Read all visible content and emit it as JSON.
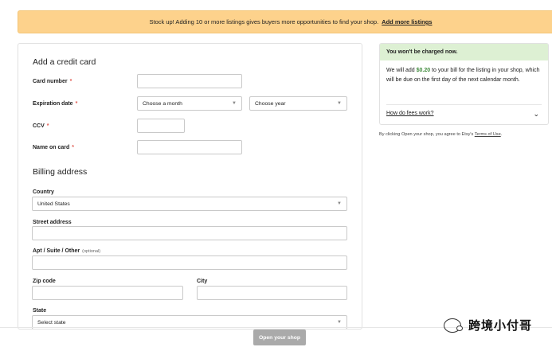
{
  "banner": {
    "text": "Stock up! Adding 10 or more listings gives buyers more opportunities to find your shop.",
    "link": "Add more listings"
  },
  "credit_card": {
    "title": "Add a credit card",
    "card_number_label": "Card number",
    "expiration_label": "Expiration date",
    "month_select": "Choose a month",
    "year_select": "Choose year",
    "ccv_label": "CCV",
    "name_label": "Name on card",
    "required_mark": "*"
  },
  "billing": {
    "title": "Billing address",
    "country_label": "Country",
    "country_value": "United States",
    "street_label": "Street address",
    "apt_label": "Apt / Suite / Other",
    "apt_optional": "(optional)",
    "zip_label": "Zip code",
    "city_label": "City",
    "state_label": "State",
    "state_value": "Select state"
  },
  "sidebar": {
    "header": "You won't be charged now.",
    "body_pre": "We will add ",
    "amount": "$0.20",
    "body_post": " to your bill for the listing in your shop, which will be due on the first day of the next calendar month.",
    "fees_link": "How do fees work?",
    "agree_pre": "By clicking Open your shop, you agree to Etsy's ",
    "agree_link": "Terms of Use",
    "agree_post": "."
  },
  "footer": {
    "open_button": "Open your shop"
  },
  "watermark": {
    "text": "跨境小付哥"
  },
  "icons": {
    "caret": "caret-down-icon",
    "chevron": "chevron-down-icon",
    "logo": "wechat-logo"
  },
  "colors": {
    "banner": "#fdd28c",
    "side_header": "#ddf0d3",
    "amount": "#3f8a3b",
    "required": "#e0584e",
    "disabled_button": "#aaaaaa"
  }
}
